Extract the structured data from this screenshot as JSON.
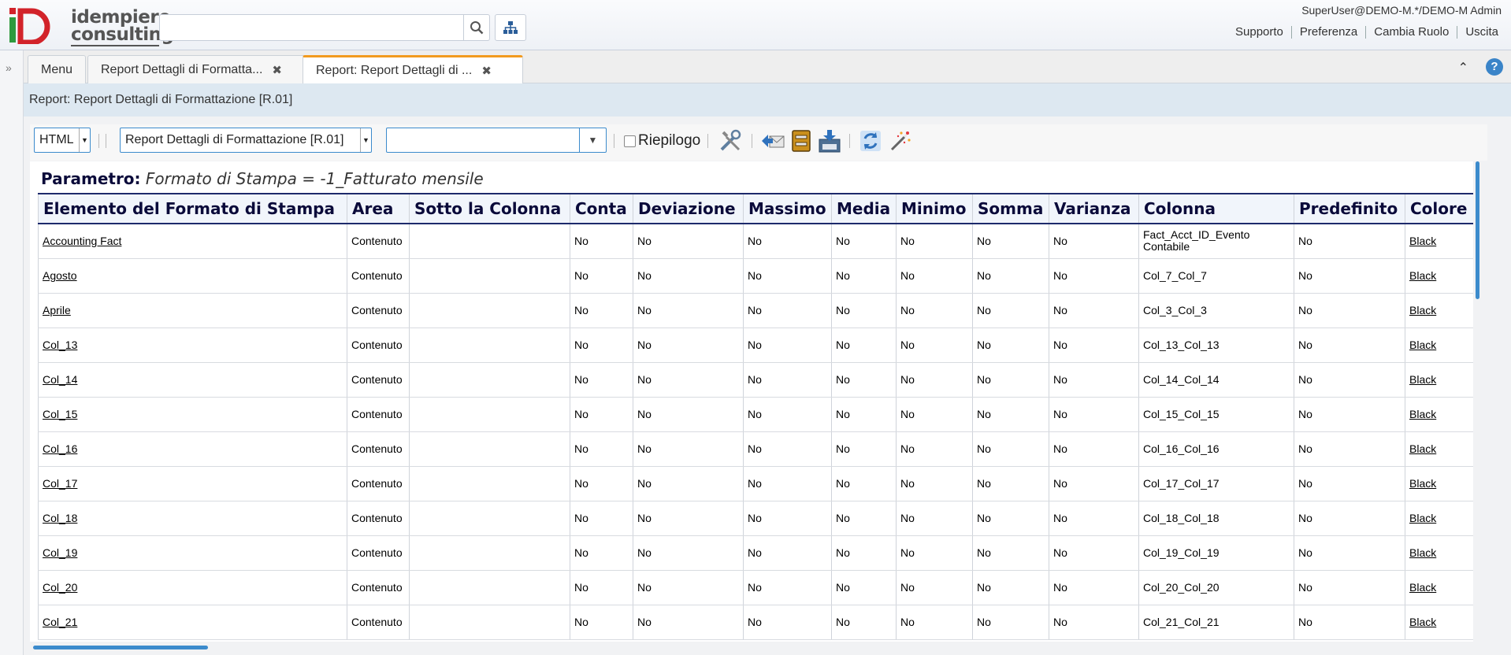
{
  "header": {
    "logo_top": "idempiere",
    "logo_bottom": "consulting",
    "search_placeholder": "",
    "user_info": "SuperUser@DEMO-M.*/DEMO-M Admin",
    "links": [
      "Supporto",
      "Preferenza",
      "Cambia Ruolo",
      "Uscita"
    ]
  },
  "tabs": [
    {
      "label": "Menu"
    },
    {
      "label": "Report Dettagli di Formatta..."
    },
    {
      "label": "Report: Report Dettagli di ..."
    }
  ],
  "title": "Report: Report Dettagli di Formattazione [R.01]",
  "toolbar": {
    "format": "HTML",
    "report": "Report Dettagli di Formattazione [R.01]",
    "combo_value": "",
    "summary_label": "Riepilogo"
  },
  "report": {
    "param_label": "Parametro:",
    "param_value": "Formato di Stampa = -1_Fatturato mensile",
    "columns": [
      "Elemento del Formato di Stampa",
      "Area",
      "Sotto la Colonna",
      "Conta",
      "Deviazione",
      "Massimo",
      "Media",
      "Minimo",
      "Somma",
      "Varianza",
      "Colonna",
      "Predefinito",
      "Colore del Formato di Stampa"
    ],
    "rows": [
      [
        "Accounting Fact",
        "Contenuto",
        "",
        "No",
        "No",
        "No",
        "No",
        "No",
        "No",
        "No",
        "Fact_Acct_ID_Evento Contabile",
        "No",
        "Black"
      ],
      [
        "Agosto",
        "Contenuto",
        "",
        "No",
        "No",
        "No",
        "No",
        "No",
        "No",
        "No",
        "Col_7_Col_7",
        "No",
        "Black"
      ],
      [
        "Aprile",
        "Contenuto",
        "",
        "No",
        "No",
        "No",
        "No",
        "No",
        "No",
        "No",
        "Col_3_Col_3",
        "No",
        "Black"
      ],
      [
        "Col_13",
        "Contenuto",
        "",
        "No",
        "No",
        "No",
        "No",
        "No",
        "No",
        "No",
        "Col_13_Col_13",
        "No",
        "Black"
      ],
      [
        "Col_14",
        "Contenuto",
        "",
        "No",
        "No",
        "No",
        "No",
        "No",
        "No",
        "No",
        "Col_14_Col_14",
        "No",
        "Black"
      ],
      [
        "Col_15",
        "Contenuto",
        "",
        "No",
        "No",
        "No",
        "No",
        "No",
        "No",
        "No",
        "Col_15_Col_15",
        "No",
        "Black"
      ],
      [
        "Col_16",
        "Contenuto",
        "",
        "No",
        "No",
        "No",
        "No",
        "No",
        "No",
        "No",
        "Col_16_Col_16",
        "No",
        "Black"
      ],
      [
        "Col_17",
        "Contenuto",
        "",
        "No",
        "No",
        "No",
        "No",
        "No",
        "No",
        "No",
        "Col_17_Col_17",
        "No",
        "Black"
      ],
      [
        "Col_18",
        "Contenuto",
        "",
        "No",
        "No",
        "No",
        "No",
        "No",
        "No",
        "No",
        "Col_18_Col_18",
        "No",
        "Black"
      ],
      [
        "Col_19",
        "Contenuto",
        "",
        "No",
        "No",
        "No",
        "No",
        "No",
        "No",
        "No",
        "Col_19_Col_19",
        "No",
        "Black"
      ],
      [
        "Col_20",
        "Contenuto",
        "",
        "No",
        "No",
        "No",
        "No",
        "No",
        "No",
        "No",
        "Col_20_Col_20",
        "No",
        "Black"
      ],
      [
        "Col_21",
        "Contenuto",
        "",
        "No",
        "No",
        "No",
        "No",
        "No",
        "No",
        "No",
        "Col_21_Col_21",
        "No",
        "Black"
      ]
    ]
  },
  "colors": {
    "accent_blue": "#3c8bcc",
    "tab_active": "#f29a1e",
    "header_navy": "#1d2a6b",
    "logo_green": "#2e9a3e",
    "logo_red": "#d2232a"
  }
}
